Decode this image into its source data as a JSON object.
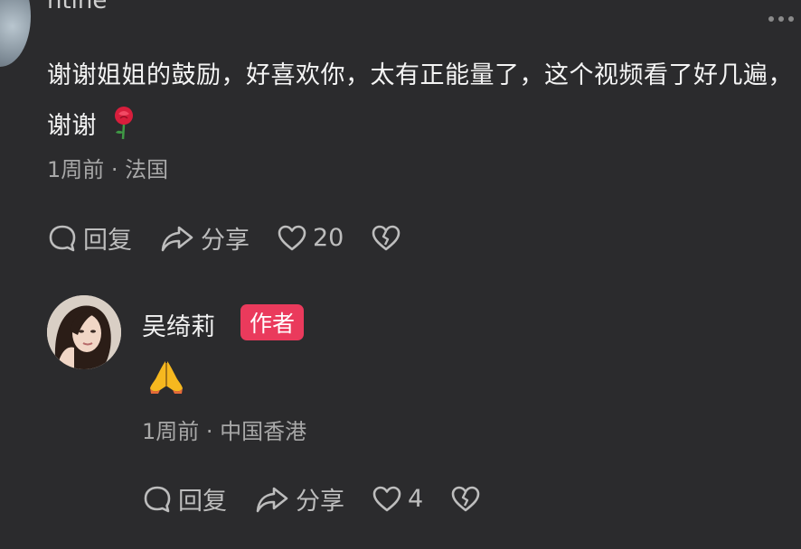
{
  "top_comment": {
    "username_fragment": "ntine",
    "text": "谢谢姐姐的鼓励，好喜欢你，太有正能量了，这个视频看了好几遍，谢谢",
    "emoji": "rose",
    "time": "1周前",
    "location": "法国",
    "actions": {
      "reply": "回复",
      "share": "分享",
      "likes": "20"
    }
  },
  "reply": {
    "username": "吴绮莉",
    "badge": "作者",
    "emoji": "folded-hands",
    "time": "1周前",
    "location": "中国香港",
    "actions": {
      "reply": "回复",
      "share": "分享",
      "likes": "4"
    }
  },
  "separator": " · ",
  "colors": {
    "background": "#2b2b2d",
    "badge": "#ea3a5c",
    "meta_text": "#a8a8a8"
  }
}
